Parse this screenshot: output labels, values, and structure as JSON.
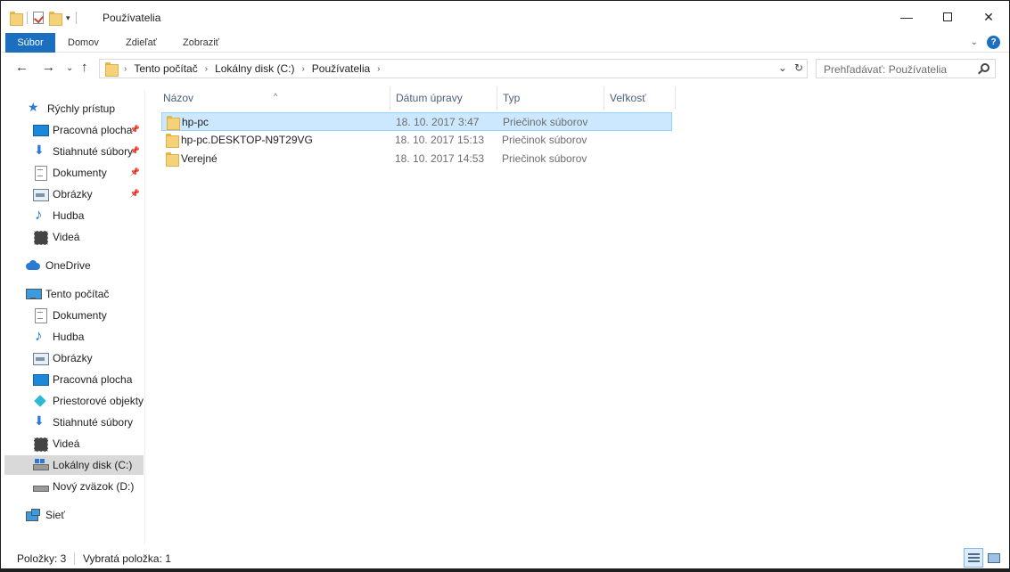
{
  "window": {
    "title": "Používatelia",
    "minimize_icon": "minimize-icon",
    "maximize_icon": "maximize-icon",
    "close_icon": "close-icon"
  },
  "ribbon": {
    "tabs": [
      "Súbor",
      "Domov",
      "Zdieľať",
      "Zobraziť"
    ],
    "accent": "#1a6fc1",
    "help_label": "?"
  },
  "address": {
    "crumbs": [
      "Tento počítač",
      "Lokálny disk (C:)",
      "Používatelia"
    ],
    "search_placeholder": "Prehľadávať: Používatelia"
  },
  "sidebar": {
    "quick_access": "Rýchly prístup",
    "quick_items": [
      "Pracovná plocha",
      "Stiahnuté súbory",
      "Dokumenty",
      "Obrázky",
      "Hudba",
      "Videá"
    ],
    "onedrive": "OneDrive",
    "this_pc": "Tento počítač",
    "pc_items": [
      "Dokumenty",
      "Hudba",
      "Obrázky",
      "Pracovná plocha",
      "Priestorové objekty",
      "Stiahnuté súbory",
      "Videá",
      "Lokálny disk (C:)",
      "Nový zväzok (D:)"
    ],
    "network": "Sieť",
    "selected": "Lokálny disk (C:)"
  },
  "table": {
    "columns": [
      "Názov",
      "Dátum úpravy",
      "Typ",
      "Veľkosť"
    ],
    "rows": [
      {
        "name": "hp-pc",
        "date": "18. 10. 2017 3:47",
        "type": "Priečinok súborov",
        "selected": true
      },
      {
        "name": "hp-pc.DESKTOP-N9T29VG",
        "date": "18. 10. 2017 15:13",
        "type": "Priečinok súborov",
        "selected": false
      },
      {
        "name": "Verejné",
        "date": "18. 10. 2017 14:53",
        "type": "Priečinok súborov",
        "selected": false
      }
    ]
  },
  "status": {
    "items": "Položky: 3",
    "selected": "Vybratá položka: 1"
  }
}
